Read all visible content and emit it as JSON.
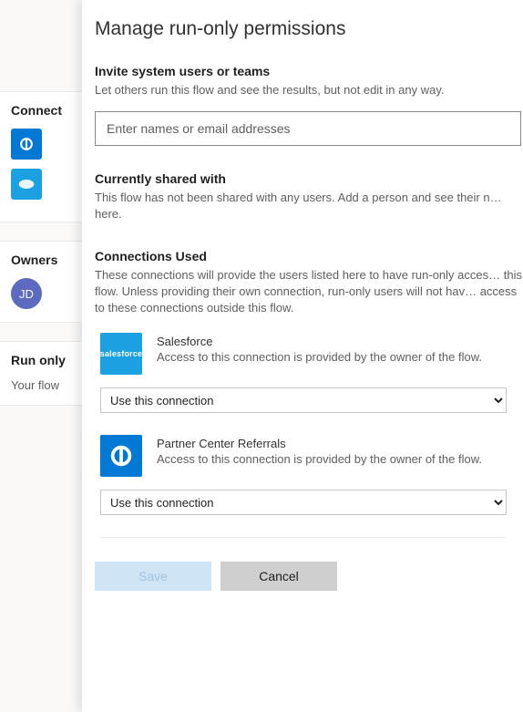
{
  "back": {
    "connect_title": "Connect",
    "owners_title": "Owners",
    "owner_initials": "JD",
    "runonly_title": "Run only",
    "runonly_body": "Your flow"
  },
  "panel": {
    "title": "Manage run-only permissions",
    "invite": {
      "heading": "Invite system users or teams",
      "desc": "Let others run this flow and see the results, but not edit in any way.",
      "placeholder": "Enter names or email addresses"
    },
    "shared": {
      "heading": "Currently shared with",
      "desc": "This flow has not been shared with any users. Add a person and see their n… here."
    },
    "connections": {
      "heading": "Connections Used",
      "desc": "These connections will provide the users listed here to have run-only acces… this flow. Unless providing their own connection, run-only users will not hav… access to these connections outside this flow.",
      "items": [
        {
          "name": "Salesforce",
          "sub": "Access to this connection is provided by the owner of the flow.",
          "select_value": "Use this connection"
        },
        {
          "name": "Partner Center Referrals",
          "sub": "Access to this connection is provided by the owner of the flow.",
          "select_value": "Use this connection"
        }
      ]
    },
    "buttons": {
      "save": "Save",
      "cancel": "Cancel"
    }
  }
}
